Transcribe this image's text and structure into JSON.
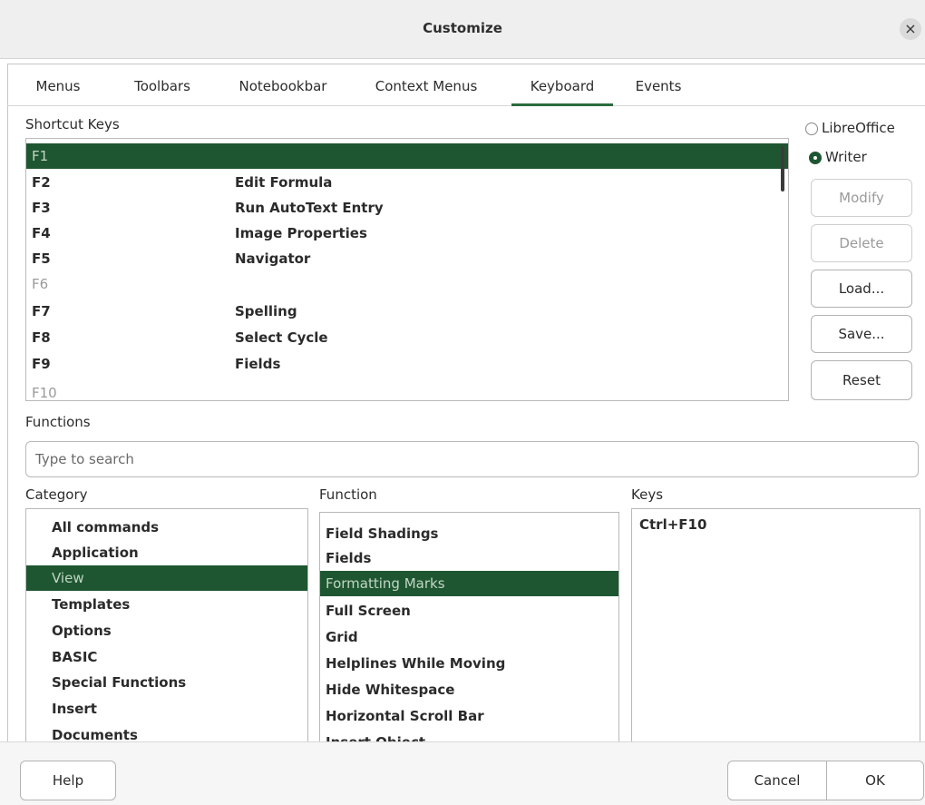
{
  "window": {
    "title": "Customize",
    "close_glyph": "×"
  },
  "tabs": [
    {
      "label": "Menus"
    },
    {
      "label": "Toolbars"
    },
    {
      "label": "Notebookbar"
    },
    {
      "label": "Context Menus"
    },
    {
      "label": "Keyboard",
      "active": true
    },
    {
      "label": "Events"
    }
  ],
  "shortcut_keys": {
    "label": "Shortcut Keys",
    "rows": [
      {
        "key": "F1",
        "function": "",
        "selected": true
      },
      {
        "key": "F2",
        "function": "Edit Formula"
      },
      {
        "key": "F3",
        "function": "Run AutoText Entry"
      },
      {
        "key": "F4",
        "function": "Image Properties"
      },
      {
        "key": "F5",
        "function": "Navigator"
      },
      {
        "key": "F6",
        "function": "",
        "dim": true
      },
      {
        "key": "F7",
        "function": "Spelling"
      },
      {
        "key": "F8",
        "function": "Select Cycle"
      },
      {
        "key": "F9",
        "function": "Fields"
      },
      {
        "key": "F10",
        "function": "",
        "dim": true
      }
    ]
  },
  "scope": {
    "libreoffice_label": "LibreOffice",
    "writer_label": "Writer",
    "selected": "Writer"
  },
  "side_buttons": {
    "modify": "Modify",
    "delete": "Delete",
    "load": "Load...",
    "save": "Save...",
    "reset": "Reset"
  },
  "functions": {
    "label": "Functions",
    "search_placeholder": "Type to search",
    "search_value": ""
  },
  "category": {
    "label": "Category",
    "items": [
      "All commands",
      "Application",
      "View",
      "Templates",
      "Options",
      "BASIC",
      "Special Functions",
      "Insert",
      "Documents"
    ],
    "selected": "View"
  },
  "function_list": {
    "label": "Function",
    "items": [
      "Field Shadings",
      "Fields",
      "Formatting Marks",
      "Full Screen",
      "Grid",
      "Helplines While Moving",
      "Hide Whitespace",
      "Horizontal Scroll Bar",
      "Insert Object"
    ],
    "selected": "Formatting Marks"
  },
  "keys_list": {
    "label": "Keys",
    "items": [
      "Ctrl+F10"
    ]
  },
  "footer": {
    "help": "Help",
    "cancel": "Cancel",
    "ok": "OK"
  },
  "colors": {
    "accent": "#1e5631",
    "selected_text": "#c2d6c4",
    "tab_underline": "#2c6b3f"
  }
}
